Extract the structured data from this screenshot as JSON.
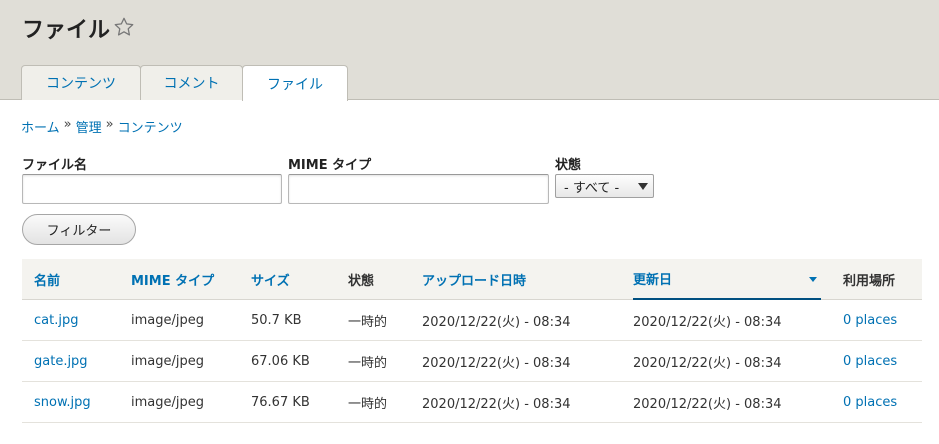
{
  "header": {
    "title": "ファイル",
    "star_icon": "star-outline-icon"
  },
  "tabs": [
    {
      "label": "コンテンツ"
    },
    {
      "label": "コメント"
    },
    {
      "label": "ファイル",
      "active": true
    }
  ],
  "breadcrumb": [
    {
      "label": "ホーム"
    },
    {
      "label": "管理"
    },
    {
      "label": "コンテンツ"
    }
  ],
  "breadcrumb_separator": "»",
  "filters": {
    "filename_label": "ファイル名",
    "filename_value": "",
    "mime_label": "MIME タイプ",
    "mime_value": "",
    "status_label": "状態",
    "status_value": "- すべて -",
    "button_label": "フィルター"
  },
  "table": {
    "columns": [
      "名前",
      "MIME タイプ",
      "サイズ",
      "状態",
      "アップロード日時",
      "更新日",
      "利用場所"
    ],
    "rows": [
      {
        "name": "cat.jpg",
        "mime": "image/jpeg",
        "size": "50.7 KB",
        "status": "一時的",
        "uploaded": "2020/12/22(火) - 08:34",
        "updated": "2020/12/22(火) - 08:34",
        "usage": "0 places"
      },
      {
        "name": "gate.jpg",
        "mime": "image/jpeg",
        "size": "67.06 KB",
        "status": "一時的",
        "uploaded": "2020/12/22(火) - 08:34",
        "updated": "2020/12/22(火) - 08:34",
        "usage": "0 places"
      },
      {
        "name": "snow.jpg",
        "mime": "image/jpeg",
        "size": "76.67 KB",
        "status": "一時的",
        "uploaded": "2020/12/22(火) - 08:34",
        "updated": "2020/12/22(火) - 08:34",
        "usage": "0 places"
      }
    ]
  },
  "colors": {
    "link": "#0071b3",
    "header_bg": "#e0ded7"
  }
}
